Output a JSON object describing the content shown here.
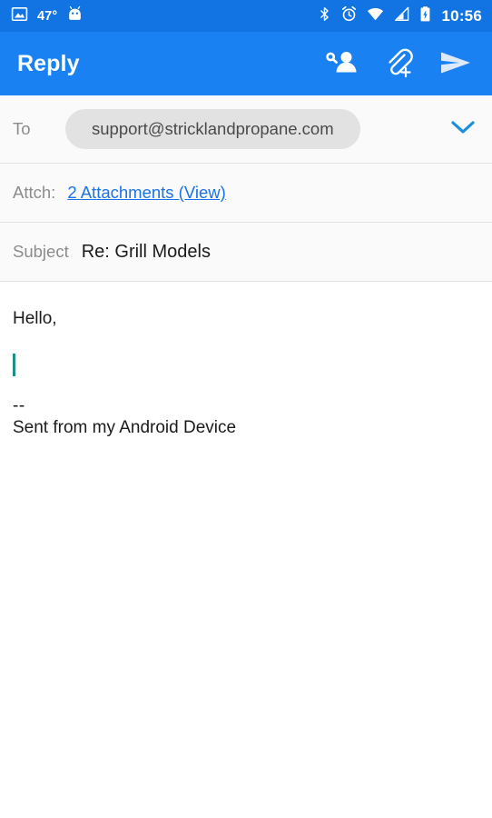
{
  "status_bar": {
    "background": "#1274e2",
    "left_icons": [
      {
        "name": "photo-icon",
        "label": "photo"
      },
      {
        "name": "android-robot-icon",
        "label": "android"
      }
    ],
    "temperature": "47°",
    "right_icons": [
      {
        "name": "bluetooth-icon",
        "label": "bluetooth"
      },
      {
        "name": "alarm-icon",
        "label": "alarm"
      },
      {
        "name": "wifi-icon",
        "label": "wifi"
      },
      {
        "name": "cellular-signal-icon",
        "label": "signal"
      },
      {
        "name": "battery-charging-icon",
        "label": "battery charging"
      }
    ],
    "clock": "10:56"
  },
  "app_bar": {
    "title": "Reply",
    "background": "#1a81f2",
    "actions": [
      {
        "name": "add-recipient-icon",
        "label": "Add recipient"
      },
      {
        "name": "attach-file-icon",
        "label": "Attach file"
      },
      {
        "name": "send-icon",
        "label": "Send"
      }
    ]
  },
  "compose": {
    "to": {
      "label": "To",
      "recipient": "support@stricklandpropane.com",
      "placeholder": "To",
      "expand_icon": "chevron-down-icon"
    },
    "attachments": {
      "label": "Attch:",
      "link_text": "2 Attachments (View)",
      "count": 2,
      "link_color": "#1a73e8"
    },
    "subject": {
      "label": "Subject",
      "value": "Re: Grill Models",
      "placeholder": "Subject"
    },
    "body": {
      "greeting": "Hello,",
      "cursor_color": "#1e9184",
      "signature_separator": "--",
      "signature": "Sent from my Android Device"
    }
  }
}
